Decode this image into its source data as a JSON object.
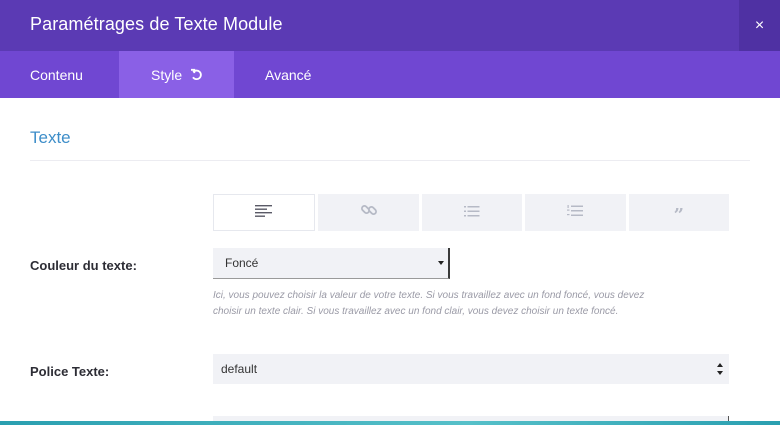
{
  "modal": {
    "title": "Paramétrages de Texte Module",
    "close_label": "×"
  },
  "tabs": [
    {
      "label": "Contenu",
      "active": false
    },
    {
      "label": "Style",
      "active": true
    },
    {
      "label": "Avancé",
      "active": false
    }
  ],
  "section": {
    "title": "Texte"
  },
  "alignment": {
    "options": [
      "align-left-icon",
      "link-icon",
      "bullet-list-icon",
      "numbered-list-icon",
      "quote-icon"
    ],
    "selected_index": 0,
    "quote_glyph": "”"
  },
  "fields": {
    "text_color": {
      "label": "Couleur du texte:",
      "value": "Foncé",
      "help": "Ici, vous pouvez choisir la valeur de votre texte. Si vous travaillez avec un fond foncé, vous devez choisir un texte clair. Si vous travaillez avec un fond clair, vous devez choisir un texte foncé."
    },
    "font": {
      "label": "Police Texte:",
      "value": "default"
    }
  },
  "colors": {
    "header": "#5b3ab4",
    "tabs": "#7047d2",
    "active_tab": "#8a60e6",
    "section_title": "#3e8ec9"
  }
}
